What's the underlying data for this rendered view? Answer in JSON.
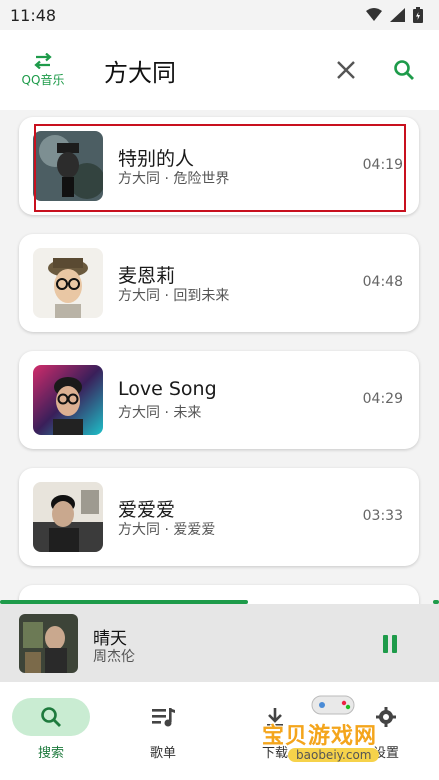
{
  "status": {
    "time": "11:48"
  },
  "header": {
    "source_label": "QQ音乐",
    "search_value": "方大同"
  },
  "songs": [
    {
      "title": "特别的人",
      "subtitle": "方大同 · 危险世界",
      "duration": "04:19"
    },
    {
      "title": "麦恩莉",
      "subtitle": "方大同 · 回到未来",
      "duration": "04:48"
    },
    {
      "title": "Love Song",
      "subtitle": "方大同 · 未来",
      "duration": "04:29"
    },
    {
      "title": "爱爱爱",
      "subtitle": "方大同 · 爱爱爱",
      "duration": "03:33"
    }
  ],
  "player": {
    "title": "晴天",
    "artist": "周杰伦",
    "progress": 0.565
  },
  "nav": [
    {
      "label": "搜索",
      "icon": "search-icon",
      "active": true
    },
    {
      "label": "歌单",
      "icon": "playlist-icon",
      "active": false
    },
    {
      "label": "下载",
      "icon": "download-icon",
      "active": false
    },
    {
      "label": "设置",
      "icon": "settings-icon",
      "active": false
    }
  ],
  "watermark": {
    "text": "宝贝游戏网",
    "url": "baobeiy.com"
  },
  "colors": {
    "accent": "#1e9b4a",
    "accent_light": "#c9ecd2",
    "highlight": "#c8101e"
  }
}
